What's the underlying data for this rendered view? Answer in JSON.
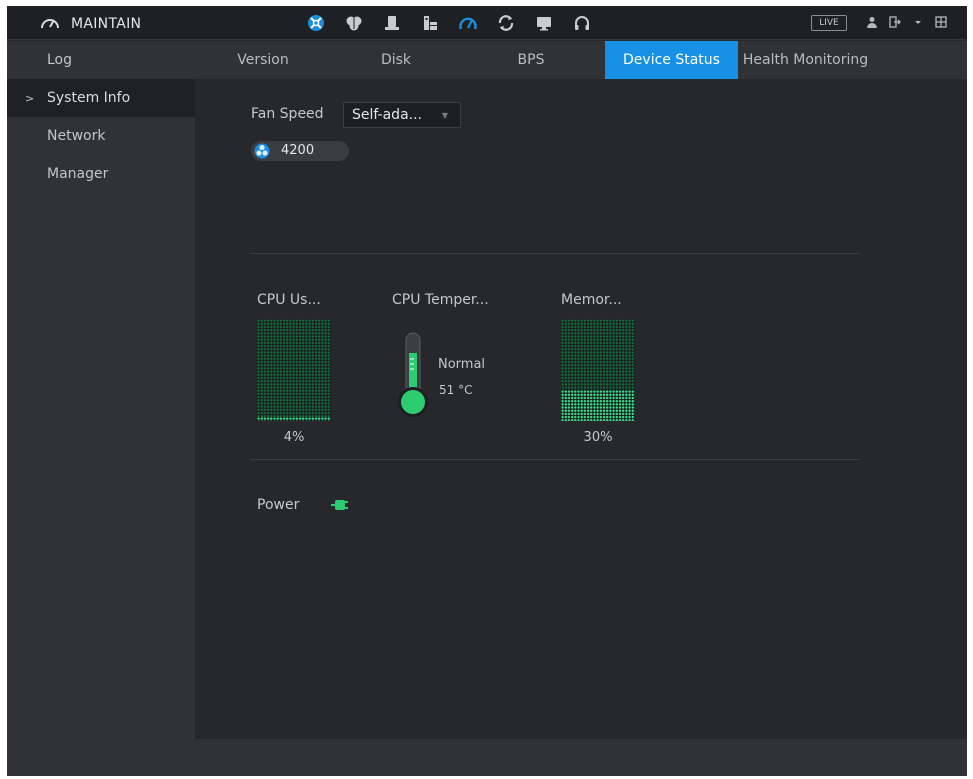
{
  "app": {
    "title": "MAINTAIN"
  },
  "topbar": {
    "icons": [
      "network-icon",
      "brain-icon",
      "storage-icon",
      "account-icon",
      "maintain-icon",
      "backup-icon",
      "display-icon",
      "audio-icon"
    ],
    "live_label": "LIVE"
  },
  "sidebar": {
    "items": [
      {
        "label": "Log"
      },
      {
        "label": "System Info",
        "active": true,
        "caret": ">"
      },
      {
        "label": "Network"
      },
      {
        "label": "Manager"
      }
    ]
  },
  "tabs": [
    {
      "label": "Version"
    },
    {
      "label": "Disk"
    },
    {
      "label": "BPS"
    },
    {
      "label": "Device Status",
      "active": true
    },
    {
      "label": "Health Monitoring"
    }
  ],
  "device_status": {
    "fan_speed_label": "Fan Speed",
    "fan_speed_mode": "Self-ada...",
    "fan_rpm": "4200",
    "cpu_usage_label": "CPU Us...",
    "cpu_usage_value": "4%",
    "cpu_usage_fraction": 0.04,
    "cpu_temp_label": "CPU Temper...",
    "cpu_temp_status": "Normal",
    "cpu_temp_value": "51 °C",
    "memory_label": "Memor...",
    "memory_value": "30%",
    "memory_fraction": 0.3,
    "power_label": "Power"
  },
  "colors": {
    "accent": "#1791e6",
    "ok_green": "#33e58a",
    "background": "#26282c"
  }
}
